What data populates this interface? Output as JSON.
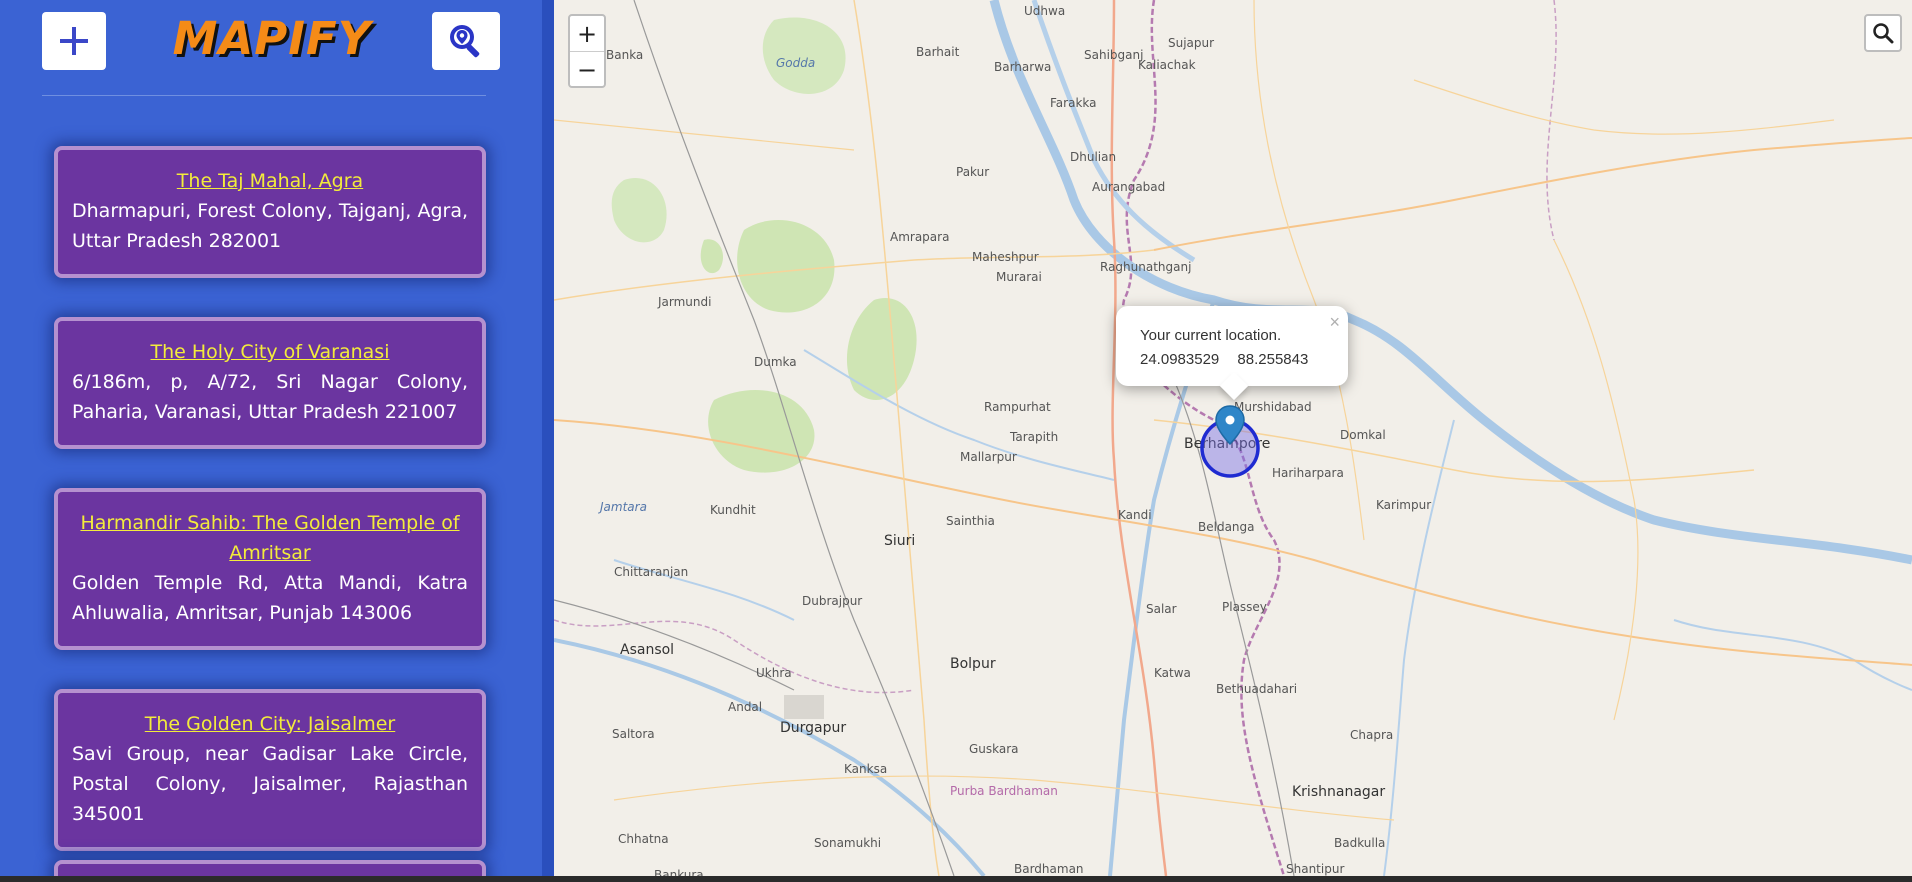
{
  "app": {
    "logo_text": "MAPIFY",
    "add_button_icon": "plus-icon",
    "locate_button_icon": "location-search-icon"
  },
  "places": [
    {
      "title": "The Taj Mahal, Agra",
      "address": "Dharmapuri, Forest Colony, Tajganj, Agra, Uttar Pradesh 282001"
    },
    {
      "title": "The Holy City of Varanasi",
      "address": "6/186m, p, A/72, Sri Nagar Colony, Paharia, Varanasi, Uttar Pradesh 221007"
    },
    {
      "title": "Harmandir Sahib: The Golden Temple of Amritsar",
      "address": "Golden Temple Rd, Atta Mandi, Katra Ahluwalia, Amritsar, Punjab 143006"
    },
    {
      "title": "The Golden City: Jaisalmer",
      "address": "Savi Group, near Gadisar Lake Circle, Postal Colony, Jaisalmer, Rajasthan 345001"
    }
  ],
  "map": {
    "zoom_in": "+",
    "zoom_out": "−",
    "popup": {
      "text": "Your current location.",
      "lat": "24.0983529",
      "lng": "88.255843",
      "close": "×"
    },
    "labels": [
      "Udhwa",
      "Banka",
      "Barhait",
      "Barharwa",
      "Sahibganj",
      "Godda",
      "Kaliachak",
      "Sujapur",
      "Farakka",
      "Pakur",
      "Dhulian",
      "Aurangabad",
      "Amrapara",
      "Maheshpur",
      "Murarai",
      "Raghunathganj",
      "Jarmundi",
      "Dumka",
      "Rampurhat",
      "Tarapith",
      "Mallarpur",
      "Murshidabad",
      "Berhampore",
      "Domkal",
      "Hariharpara",
      "Karimpur",
      "Kandi",
      "Beldanga",
      "Sainthia",
      "Kundhit",
      "Siuri",
      "Jamtara",
      "Chittaranjan",
      "Dubrajpur",
      "Salar",
      "Plassey",
      "Asansol",
      "Ukhra",
      "Bolpur",
      "Katwa",
      "Bethuadahari",
      "Andal",
      "Durgapur",
      "Saltora",
      "Kanksa",
      "Guskara",
      "Purba Bardhaman",
      "Chapra",
      "Krishnanagar",
      "Chhatna",
      "Sonamukhi",
      "Badkulla",
      "Bardhaman",
      "Shantipur",
      "Bankura"
    ]
  },
  "colors": {
    "sidebar_bg": "#3b63d3",
    "card_bg": "#6b35a0",
    "card_title": "#f3ec3b",
    "logo": "#f58b17",
    "location_circle": "#1f2bd1",
    "marker": "#2f86c8"
  }
}
